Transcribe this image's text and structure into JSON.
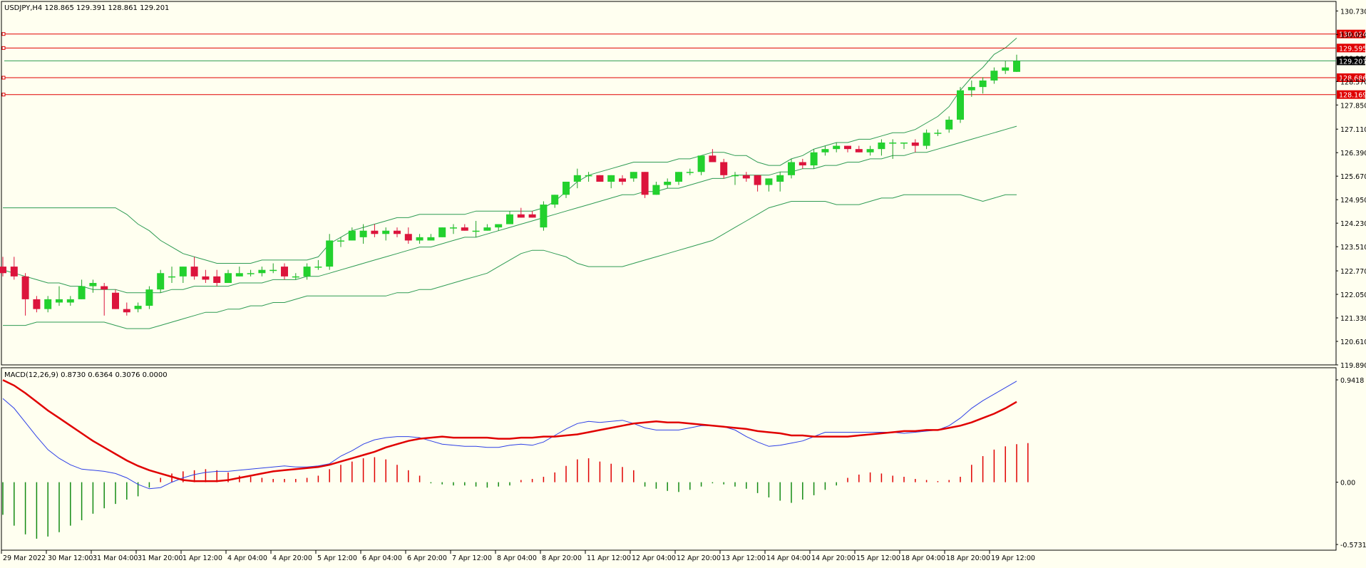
{
  "chart_data": [
    {
      "type": "candlestick",
      "title": "USDJPY,H4  128.865 129.391 128.861 129.201",
      "symbol": "USDJPY",
      "timeframe": "H4",
      "last_bar": {
        "open": 128.865,
        "high": 129.391,
        "low": 128.861,
        "close": 129.201
      },
      "last_price_label": "129.201",
      "ylim": [
        119.89,
        131.0
      ],
      "y_ticks": [
        "130.730",
        "130.010",
        "129.290",
        "128.570",
        "127.850",
        "127.110",
        "126.390",
        "125.670",
        "124.950",
        "124.230",
        "123.510",
        "122.770",
        "122.050",
        "121.330",
        "120.610",
        "119.890"
      ],
      "x_tick_labels": [
        "29 Mar 2022",
        "30 Mar 12:00",
        "31 Mar 04:00",
        "31 Mar 20:00",
        "1 Apr 12:00",
        "4 Apr 04:00",
        "4 Apr 20:00",
        "5 Apr 12:00",
        "6 Apr 04:00",
        "6 Apr 20:00",
        "7 Apr 12:00",
        "8 Apr 04:00",
        "8 Apr 20:00",
        "11 Apr 12:00",
        "12 Apr 04:00",
        "12 Apr 20:00",
        "13 Apr 12:00",
        "14 Apr 04:00",
        "14 Apr 20:00",
        "15 Apr 12:00",
        "18 Apr 04:00",
        "18 Apr 20:00",
        "19 Apr 12:00"
      ],
      "horizontal_levels": [
        {
          "price": 130.024,
          "label": "130.024"
        },
        {
          "price": 129.595,
          "label": "129.595"
        },
        {
          "price": 128.686,
          "label": "128.686"
        },
        {
          "price": 128.169,
          "label": "128.169"
        }
      ],
      "candles": [
        [
          122.9,
          123.2,
          122.6,
          122.7
        ],
        [
          122.9,
          123.2,
          122.5,
          122.6
        ],
        [
          122.6,
          122.7,
          121.4,
          121.9
        ],
        [
          121.9,
          122.0,
          121.5,
          121.6
        ],
        [
          121.6,
          122.0,
          121.5,
          121.9
        ],
        [
          121.8,
          122.3,
          121.7,
          121.9
        ],
        [
          121.8,
          122.0,
          121.7,
          121.9
        ],
        [
          121.9,
          122.5,
          121.9,
          122.3
        ],
        [
          122.3,
          122.5,
          122.1,
          122.4
        ],
        [
          122.3,
          122.4,
          121.4,
          122.2
        ],
        [
          122.1,
          122.2,
          121.6,
          121.6
        ],
        [
          121.6,
          121.8,
          121.4,
          121.5
        ],
        [
          121.6,
          121.8,
          121.5,
          121.7
        ],
        [
          121.7,
          122.3,
          121.6,
          122.2
        ],
        [
          122.2,
          122.8,
          122.1,
          122.7
        ],
        [
          122.6,
          122.9,
          122.4,
          122.6
        ],
        [
          122.6,
          122.9,
          122.4,
          122.9
        ],
        [
          122.9,
          123.2,
          122.5,
          122.6
        ],
        [
          122.6,
          122.8,
          122.4,
          122.5
        ],
        [
          122.6,
          122.8,
          122.3,
          122.4
        ],
        [
          122.4,
          122.8,
          122.4,
          122.7
        ],
        [
          122.6,
          122.9,
          122.6,
          122.7
        ],
        [
          122.7,
          122.8,
          122.6,
          122.7
        ],
        [
          122.7,
          122.9,
          122.6,
          122.8
        ],
        [
          122.8,
          123.0,
          122.7,
          122.8
        ],
        [
          122.9,
          123.0,
          122.5,
          122.6
        ],
        [
          122.6,
          122.7,
          122.5,
          122.6
        ],
        [
          122.6,
          123.0,
          122.5,
          122.9
        ],
        [
          122.9,
          123.1,
          122.8,
          122.9
        ],
        [
          122.9,
          123.9,
          122.8,
          123.7
        ],
        [
          123.7,
          123.8,
          123.5,
          123.7
        ],
        [
          123.7,
          124.1,
          123.7,
          124.0
        ],
        [
          123.8,
          124.2,
          123.6,
          124.0
        ],
        [
          124.0,
          124.2,
          123.8,
          123.9
        ],
        [
          123.9,
          124.1,
          123.7,
          124.0
        ],
        [
          124.0,
          124.1,
          123.8,
          123.9
        ],
        [
          123.9,
          124.1,
          123.6,
          123.7
        ],
        [
          123.7,
          123.9,
          123.6,
          123.8
        ],
        [
          123.7,
          123.9,
          123.7,
          123.8
        ],
        [
          123.8,
          124.1,
          123.8,
          124.1
        ],
        [
          124.1,
          124.2,
          123.9,
          124.1
        ],
        [
          124.1,
          124.2,
          124.0,
          124.0
        ],
        [
          124.0,
          124.3,
          123.8,
          124.0
        ],
        [
          124.0,
          124.2,
          124.0,
          124.1
        ],
        [
          124.1,
          124.2,
          124.0,
          124.2
        ],
        [
          124.2,
          124.6,
          124.2,
          124.5
        ],
        [
          124.5,
          124.7,
          124.4,
          124.4
        ],
        [
          124.5,
          124.6,
          124.4,
          124.4
        ],
        [
          124.1,
          124.9,
          124.0,
          124.8
        ],
        [
          124.8,
          125.1,
          124.7,
          125.1
        ],
        [
          125.1,
          125.5,
          125.0,
          125.5
        ],
        [
          125.5,
          125.9,
          125.3,
          125.7
        ],
        [
          125.7,
          125.8,
          125.5,
          125.7
        ],
        [
          125.7,
          125.7,
          125.5,
          125.5
        ],
        [
          125.5,
          125.7,
          125.3,
          125.7
        ],
        [
          125.6,
          125.7,
          125.4,
          125.5
        ],
        [
          125.6,
          125.8,
          125.5,
          125.8
        ],
        [
          125.8,
          125.8,
          125.0,
          125.1
        ],
        [
          125.1,
          125.5,
          125.1,
          125.4
        ],
        [
          125.4,
          125.6,
          125.3,
          125.5
        ],
        [
          125.5,
          125.8,
          125.4,
          125.8
        ],
        [
          125.8,
          125.9,
          125.7,
          125.8
        ],
        [
          125.8,
          126.3,
          125.7,
          126.3
        ],
        [
          126.3,
          126.5,
          126.1,
          126.1
        ],
        [
          126.1,
          126.2,
          125.6,
          125.7
        ],
        [
          125.7,
          125.8,
          125.4,
          125.7
        ],
        [
          125.7,
          125.8,
          125.5,
          125.6
        ],
        [
          125.7,
          125.7,
          125.2,
          125.4
        ],
        [
          125.4,
          125.6,
          125.2,
          125.6
        ],
        [
          125.5,
          125.8,
          125.2,
          125.7
        ],
        [
          125.7,
          126.2,
          125.6,
          126.1
        ],
        [
          126.1,
          126.2,
          125.9,
          126.0
        ],
        [
          126.0,
          126.5,
          125.9,
          126.4
        ],
        [
          126.4,
          126.6,
          126.3,
          126.5
        ],
        [
          126.5,
          126.7,
          126.4,
          126.6
        ],
        [
          126.6,
          126.6,
          126.4,
          126.5
        ],
        [
          126.5,
          126.6,
          126.4,
          126.4
        ],
        [
          126.4,
          126.6,
          126.3,
          126.5
        ],
        [
          126.5,
          126.8,
          126.3,
          126.7
        ],
        [
          126.7,
          126.8,
          126.2,
          126.7
        ],
        [
          126.7,
          126.7,
          126.5,
          126.7
        ],
        [
          126.7,
          126.8,
          126.4,
          126.6
        ],
        [
          126.6,
          127.1,
          126.5,
          127.0
        ],
        [
          127.0,
          127.1,
          126.9,
          127.0
        ],
        [
          127.1,
          127.5,
          127.0,
          127.4
        ],
        [
          127.4,
          128.4,
          127.3,
          128.3
        ],
        [
          128.3,
          128.6,
          128.1,
          128.4
        ],
        [
          128.4,
          128.7,
          128.2,
          128.6
        ],
        [
          128.6,
          129.0,
          128.5,
          128.9
        ],
        [
          128.9,
          129.2,
          128.8,
          129.0
        ],
        [
          128.865,
          129.391,
          128.861,
          129.201
        ]
      ],
      "bands": {
        "upper": [
          124.7,
          124.7,
          124.7,
          124.7,
          124.7,
          124.7,
          124.7,
          124.7,
          124.7,
          124.7,
          124.7,
          124.5,
          124.2,
          124.0,
          123.7,
          123.5,
          123.3,
          123.2,
          123.1,
          123.0,
          123.0,
          123.0,
          123.0,
          123.1,
          123.1,
          123.1,
          123.1,
          123.1,
          123.2,
          123.6,
          123.8,
          124.0,
          124.1,
          124.2,
          124.3,
          124.4,
          124.4,
          124.5,
          124.5,
          124.5,
          124.5,
          124.5,
          124.6,
          124.6,
          124.6,
          124.6,
          124.6,
          124.6,
          124.7,
          124.9,
          125.2,
          125.5,
          125.7,
          125.8,
          125.9,
          126.0,
          126.1,
          126.1,
          126.1,
          126.1,
          126.2,
          126.2,
          126.3,
          126.4,
          126.4,
          126.3,
          126.3,
          126.1,
          126.0,
          126.0,
          126.2,
          126.3,
          126.5,
          126.6,
          126.7,
          126.7,
          126.8,
          126.8,
          126.9,
          127.0,
          127.0,
          127.1,
          127.3,
          127.5,
          127.8,
          128.3,
          128.7,
          129.0,
          129.4,
          129.6,
          129.9
        ],
        "middle": [
          122.8,
          122.7,
          122.6,
          122.5,
          122.4,
          122.4,
          122.3,
          122.3,
          122.2,
          122.2,
          122.2,
          122.1,
          122.1,
          122.1,
          122.1,
          122.2,
          122.2,
          122.3,
          122.3,
          122.3,
          122.3,
          122.4,
          122.4,
          122.4,
          122.5,
          122.5,
          122.5,
          122.6,
          122.6,
          122.7,
          122.8,
          122.9,
          123.0,
          123.1,
          123.2,
          123.3,
          123.4,
          123.5,
          123.5,
          123.6,
          123.7,
          123.8,
          123.8,
          123.9,
          124.0,
          124.1,
          124.2,
          124.3,
          124.4,
          124.5,
          124.6,
          124.7,
          124.8,
          124.9,
          125.0,
          125.1,
          125.1,
          125.2,
          125.2,
          125.3,
          125.3,
          125.4,
          125.5,
          125.6,
          125.6,
          125.7,
          125.7,
          125.7,
          125.7,
          125.8,
          125.8,
          125.9,
          125.9,
          126.0,
          126.0,
          126.1,
          126.1,
          126.2,
          126.2,
          126.3,
          126.3,
          126.4,
          126.4,
          126.5,
          126.6,
          126.7,
          126.8,
          126.9,
          127.0,
          127.1,
          127.2
        ],
        "lower": [
          121.1,
          121.1,
          121.1,
          121.2,
          121.2,
          121.2,
          121.2,
          121.2,
          121.2,
          121.2,
          121.1,
          121.0,
          121.0,
          121.0,
          121.1,
          121.2,
          121.3,
          121.4,
          121.5,
          121.5,
          121.6,
          121.6,
          121.7,
          121.7,
          121.8,
          121.8,
          121.9,
          122.0,
          122.0,
          122.0,
          122.0,
          122.0,
          122.0,
          122.0,
          122.0,
          122.1,
          122.1,
          122.2,
          122.2,
          122.3,
          122.4,
          122.5,
          122.6,
          122.7,
          122.9,
          123.1,
          123.3,
          123.4,
          123.4,
          123.3,
          123.2,
          123.0,
          122.9,
          122.9,
          122.9,
          122.9,
          123.0,
          123.1,
          123.2,
          123.3,
          123.4,
          123.5,
          123.6,
          123.7,
          123.9,
          124.1,
          124.3,
          124.5,
          124.7,
          124.8,
          124.9,
          124.9,
          124.9,
          124.9,
          124.8,
          124.8,
          124.8,
          124.9,
          125.0,
          125.0,
          125.1,
          125.1,
          125.1,
          125.1,
          125.1,
          125.1,
          125.0,
          124.9,
          125.0,
          125.1,
          125.1
        ]
      }
    },
    {
      "type": "histogram",
      "title": "MACD(12,26,9) 0.8730 0.6364 0.3076 0.0000",
      "parameters": "12,26,9",
      "header_values": [
        "0.8730",
        "0.6364",
        "0.3076",
        "0.0000"
      ],
      "ylim": [
        -0.5731,
        0.9418
      ],
      "y_ticks": [
        "0.9418",
        "0.00",
        "-0.5731"
      ],
      "histogram": [
        -0.3,
        -0.4,
        -0.48,
        -0.52,
        -0.5,
        -0.46,
        -0.4,
        -0.35,
        -0.29,
        -0.24,
        -0.2,
        -0.16,
        -0.13,
        -0.05,
        0.04,
        0.08,
        0.1,
        0.11,
        0.12,
        0.11,
        0.09,
        0.06,
        0.05,
        0.04,
        0.03,
        0.03,
        0.03,
        0.04,
        0.06,
        0.12,
        0.16,
        0.19,
        0.22,
        0.23,
        0.21,
        0.16,
        0.11,
        0.06,
        -0.01,
        -0.02,
        -0.03,
        -0.03,
        -0.04,
        -0.05,
        -0.04,
        -0.03,
        0.02,
        0.03,
        0.05,
        0.09,
        0.15,
        0.21,
        0.22,
        0.19,
        0.17,
        0.14,
        0.11,
        -0.04,
        -0.06,
        -0.08,
        -0.09,
        -0.07,
        -0.04,
        -0.01,
        -0.02,
        -0.04,
        -0.06,
        -0.1,
        -0.14,
        -0.17,
        -0.19,
        -0.16,
        -0.12,
        -0.07,
        -0.03,
        0.04,
        0.07,
        0.09,
        0.08,
        0.06,
        0.05,
        0.03,
        0.02,
        0.01,
        0.02,
        0.05,
        0.16,
        0.24,
        0.3,
        0.33,
        0.35,
        0.36
      ],
      "macd_line": [
        0.77,
        0.68,
        0.55,
        0.42,
        0.3,
        0.22,
        0.16,
        0.12,
        0.11,
        0.1,
        0.08,
        0.04,
        -0.02,
        -0.06,
        -0.05,
        0.0,
        0.04,
        0.07,
        0.09,
        0.1,
        0.1,
        0.11,
        0.12,
        0.13,
        0.14,
        0.15,
        0.14,
        0.14,
        0.15,
        0.17,
        0.24,
        0.29,
        0.35,
        0.39,
        0.41,
        0.42,
        0.42,
        0.41,
        0.38,
        0.35,
        0.34,
        0.33,
        0.33,
        0.32,
        0.32,
        0.34,
        0.35,
        0.34,
        0.37,
        0.43,
        0.49,
        0.54,
        0.56,
        0.55,
        0.56,
        0.57,
        0.54,
        0.5,
        0.48,
        0.48,
        0.48,
        0.5,
        0.52,
        0.52,
        0.51,
        0.48,
        0.42,
        0.37,
        0.33,
        0.34,
        0.36,
        0.38,
        0.42,
        0.46,
        0.46,
        0.46,
        0.46,
        0.46,
        0.46,
        0.46,
        0.45,
        0.46,
        0.47,
        0.48,
        0.52,
        0.59,
        0.68,
        0.75,
        0.81,
        0.87,
        0.93
      ],
      "signal_line": [
        0.94,
        0.89,
        0.82,
        0.74,
        0.66,
        0.59,
        0.52,
        0.45,
        0.38,
        0.32,
        0.26,
        0.2,
        0.15,
        0.11,
        0.08,
        0.05,
        0.02,
        0.01,
        0.01,
        0.01,
        0.02,
        0.04,
        0.06,
        0.08,
        0.1,
        0.11,
        0.12,
        0.13,
        0.14,
        0.16,
        0.19,
        0.22,
        0.25,
        0.28,
        0.32,
        0.35,
        0.38,
        0.4,
        0.41,
        0.42,
        0.41,
        0.41,
        0.41,
        0.41,
        0.4,
        0.4,
        0.41,
        0.41,
        0.42,
        0.42,
        0.43,
        0.44,
        0.46,
        0.48,
        0.5,
        0.52,
        0.54,
        0.55,
        0.56,
        0.55,
        0.55,
        0.54,
        0.53,
        0.52,
        0.51,
        0.5,
        0.49,
        0.47,
        0.46,
        0.45,
        0.43,
        0.43,
        0.42,
        0.42,
        0.42,
        0.42,
        0.43,
        0.44,
        0.45,
        0.46,
        0.47,
        0.47,
        0.48,
        0.48,
        0.5,
        0.52,
        0.55,
        0.59,
        0.63,
        0.68,
        0.74
      ]
    }
  ],
  "colors": {
    "background": "#fffff0",
    "bull_candle": "#23d12e",
    "bear_candle": "#dc143c",
    "wick_bull": "#1fa024",
    "wick_bear": "#dc143c",
    "bands": "#2e9b53",
    "level_line": "#e00000",
    "level_label": "#e00000",
    "last_price_label_bg": "#000000",
    "hist_up": "#e00000",
    "hist_down": "#138a13",
    "macd_line": "#2d3fe6",
    "signal_line": "#e00000",
    "axis_text": "#000000",
    "frame": "#000000"
  }
}
